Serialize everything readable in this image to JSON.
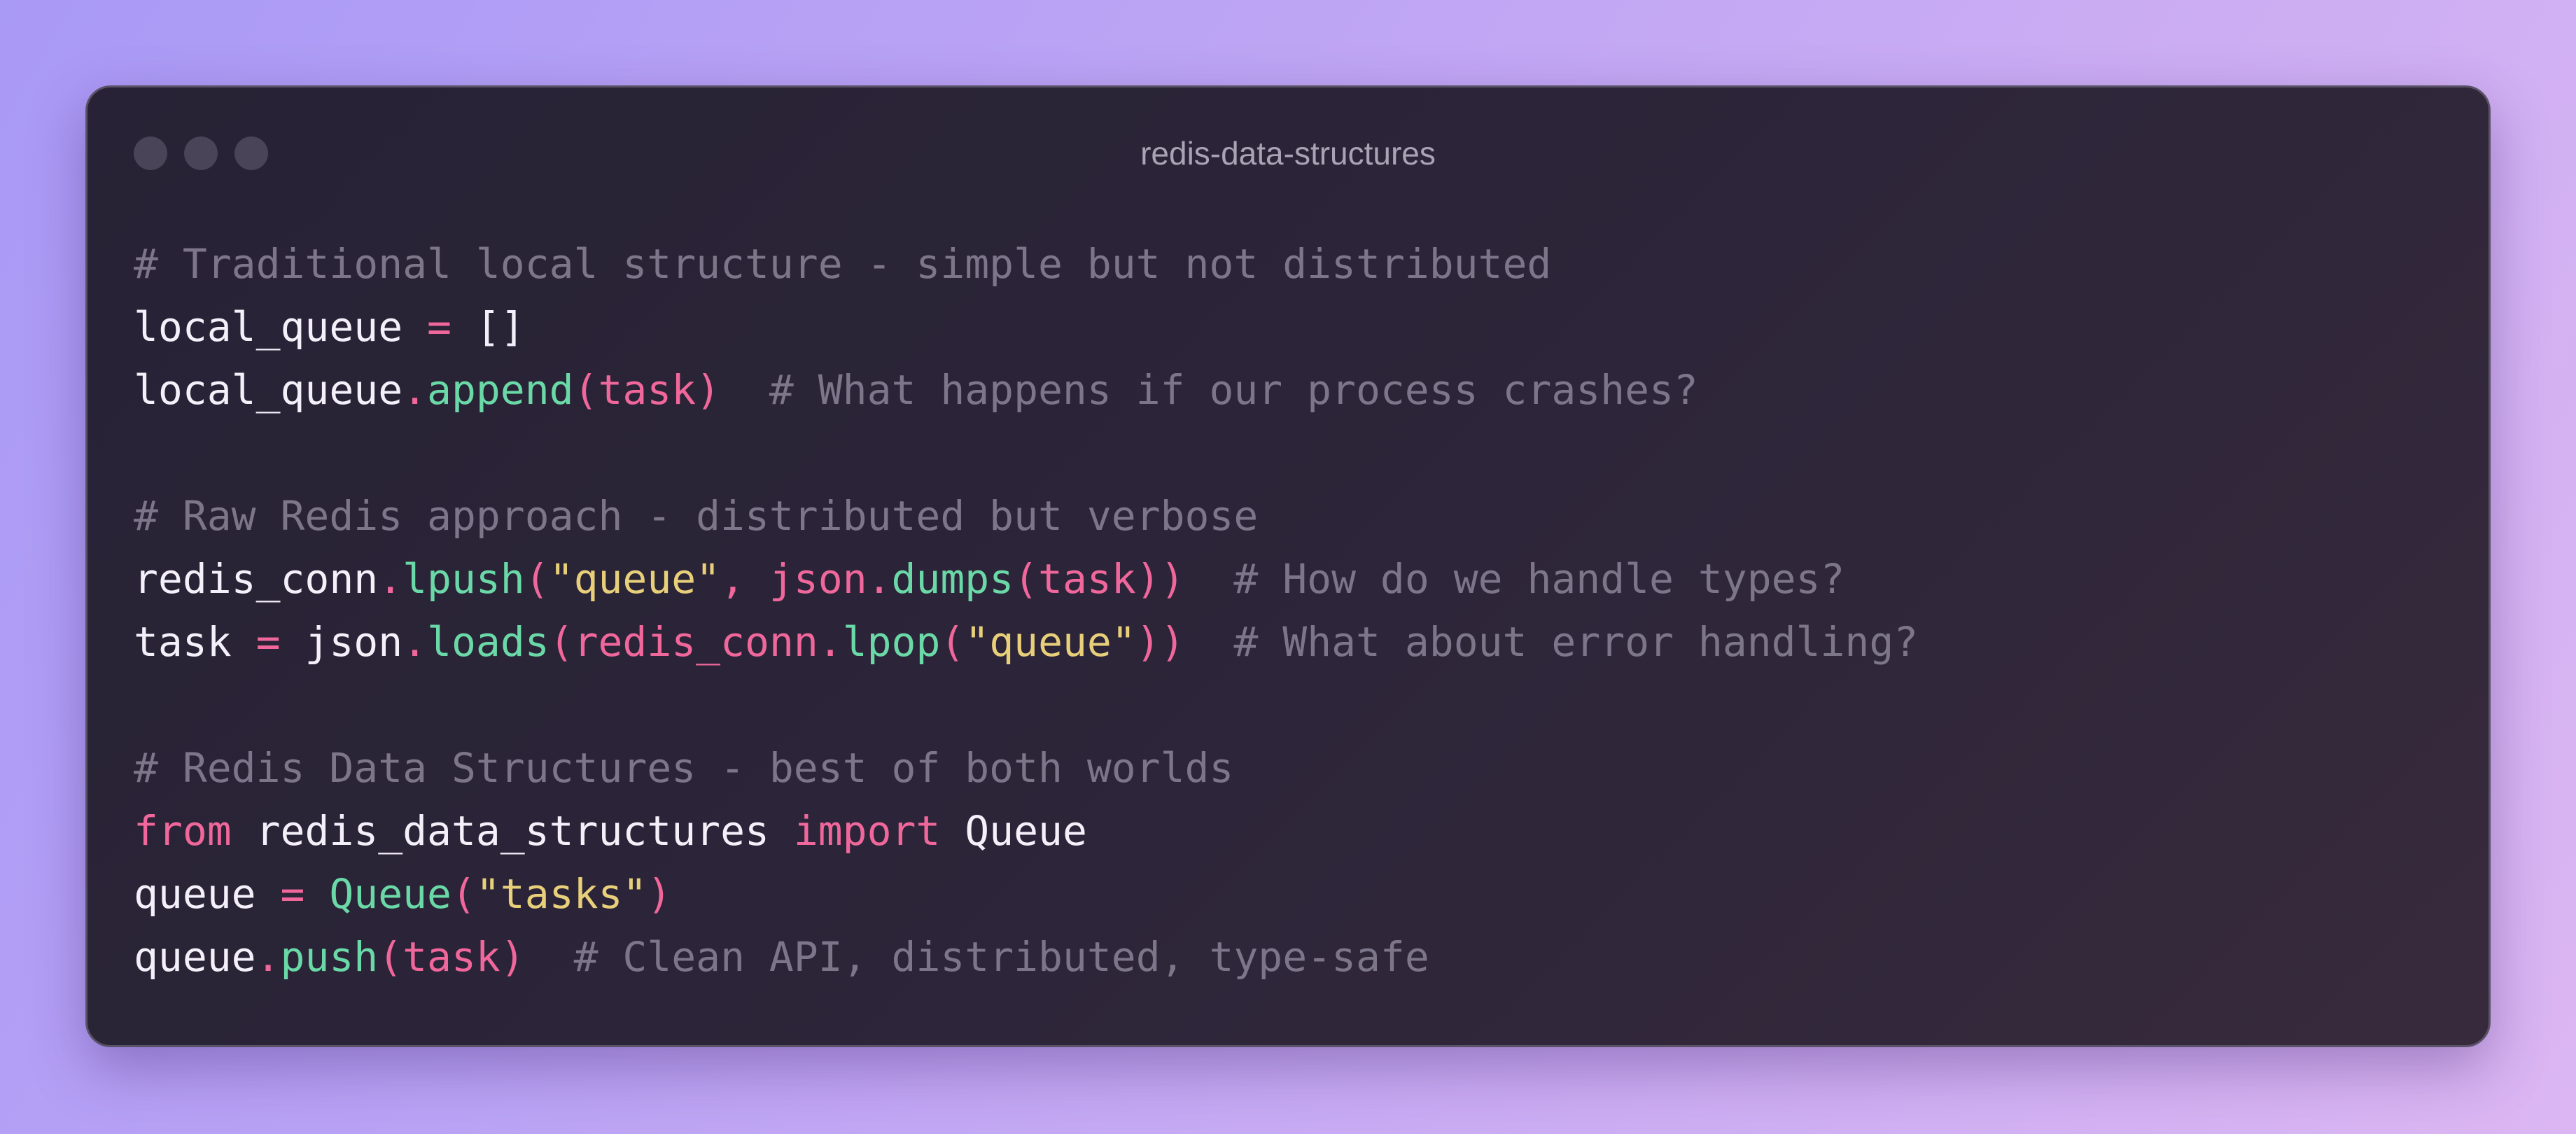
{
  "window": {
    "title": "redis-data-structures",
    "colors": {
      "background_from": "#a99af6",
      "background_to": "#dbb6f2",
      "window_bg": "#2a2438",
      "comment": "#7d768a",
      "plain": "#f4f0fa",
      "operator": "#f0679b",
      "function": "#6ad9a7",
      "string": "#e8d07a",
      "keyword": "#f0679b"
    }
  },
  "code": {
    "lines": [
      [
        {
          "t": "comment",
          "v": "# Traditional local structure - simple but not distributed"
        }
      ],
      [
        {
          "t": "plain",
          "v": "local_queue "
        },
        {
          "t": "op",
          "v": "="
        },
        {
          "t": "plain",
          "v": " []"
        }
      ],
      [
        {
          "t": "plain",
          "v": "local_queue"
        },
        {
          "t": "op",
          "v": "."
        },
        {
          "t": "fn",
          "v": "append"
        },
        {
          "t": "paren",
          "v": "(task)"
        },
        {
          "t": "plain",
          "v": "  "
        },
        {
          "t": "comment",
          "v": "# What happens if our process crashes?"
        }
      ],
      [],
      [
        {
          "t": "comment",
          "v": "# Raw Redis approach - distributed but verbose"
        }
      ],
      [
        {
          "t": "plain",
          "v": "redis_conn"
        },
        {
          "t": "op",
          "v": "."
        },
        {
          "t": "fn",
          "v": "lpush"
        },
        {
          "t": "paren",
          "v": "("
        },
        {
          "t": "str",
          "v": "\"queue\""
        },
        {
          "t": "paren",
          "v": ", json"
        },
        {
          "t": "op",
          "v": "."
        },
        {
          "t": "fn",
          "v": "dumps"
        },
        {
          "t": "paren",
          "v": "(task))"
        },
        {
          "t": "plain",
          "v": "  "
        },
        {
          "t": "comment",
          "v": "# How do we handle types?"
        }
      ],
      [
        {
          "t": "plain",
          "v": "task "
        },
        {
          "t": "op",
          "v": "="
        },
        {
          "t": "plain",
          "v": " json"
        },
        {
          "t": "op",
          "v": "."
        },
        {
          "t": "fn",
          "v": "loads"
        },
        {
          "t": "paren",
          "v": "(redis_conn"
        },
        {
          "t": "op",
          "v": "."
        },
        {
          "t": "fn",
          "v": "lpop"
        },
        {
          "t": "paren",
          "v": "("
        },
        {
          "t": "str",
          "v": "\"queue\""
        },
        {
          "t": "paren",
          "v": "))"
        },
        {
          "t": "plain",
          "v": "  "
        },
        {
          "t": "comment",
          "v": "# What about error handling?"
        }
      ],
      [],
      [
        {
          "t": "comment",
          "v": "# Redis Data Structures - best of both worlds"
        }
      ],
      [
        {
          "t": "kw",
          "v": "from"
        },
        {
          "t": "plain",
          "v": " redis_data_structures "
        },
        {
          "t": "kw",
          "v": "import"
        },
        {
          "t": "plain",
          "v": " Queue"
        }
      ],
      [
        {
          "t": "plain",
          "v": "queue "
        },
        {
          "t": "op",
          "v": "="
        },
        {
          "t": "plain",
          "v": " "
        },
        {
          "t": "fn",
          "v": "Queue"
        },
        {
          "t": "paren",
          "v": "("
        },
        {
          "t": "str",
          "v": "\"tasks\""
        },
        {
          "t": "paren",
          "v": ")"
        }
      ],
      [
        {
          "t": "plain",
          "v": "queue"
        },
        {
          "t": "op",
          "v": "."
        },
        {
          "t": "fn",
          "v": "push"
        },
        {
          "t": "paren",
          "v": "(task)"
        },
        {
          "t": "plain",
          "v": "  "
        },
        {
          "t": "comment",
          "v": "# Clean API, distributed, type-safe"
        }
      ]
    ]
  }
}
